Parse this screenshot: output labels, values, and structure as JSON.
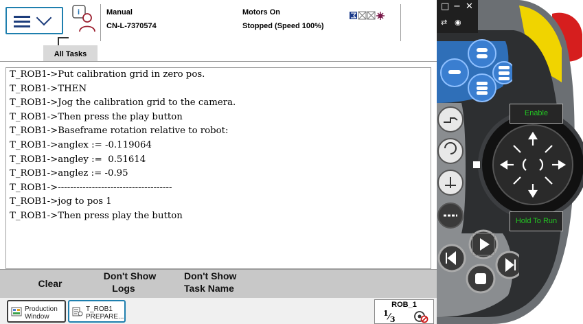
{
  "header": {
    "mode": "Manual",
    "controller_name": "CN-L-7370574",
    "motors_state": "Motors On",
    "run_state": "Stopped (Speed 100%)"
  },
  "tabs": [
    {
      "label": "All Tasks"
    }
  ],
  "log_lines": [
    "T_ROB1->Put calibration grid in zero pos.",
    "T_ROB1->THEN",
    "T_ROB1->Jog the calibration grid to the camera.",
    "T_ROB1->Then press the play button",
    "T_ROB1->Baseframe rotation relative to robot:",
    "T_ROB1->anglex := -0.119064",
    "T_ROB1->angley :=  0.51614",
    "T_ROB1->anglez := -0.95",
    "T_ROB1->-------------------------------------",
    "T_ROB1->jog to pos 1",
    "T_ROB1->Then press play the button"
  ],
  "commands": {
    "clear": "Clear",
    "dont_show_logs_1": "Don't Show",
    "dont_show_logs_2": "Logs",
    "dont_show_task_1": "Don't Show",
    "dont_show_task_2": "Task Name"
  },
  "taskbar": {
    "production_1": "Production",
    "production_2": "Window",
    "trob_1": "T_ROB1",
    "trob_2": "PREPARE..."
  },
  "rob_status": {
    "title": "ROB_1",
    "fraction_num": "1",
    "fraction_den": "3"
  },
  "hardware": {
    "enable_label": "Enable",
    "hold_label": "Hold To Run"
  },
  "colors": {
    "accent_blue": "#1e7fae",
    "pendant_blue": "#2f6fb8",
    "panel_gray": "#c8c8c8",
    "green_text": "#23c423",
    "emergency_red": "#d61e1e",
    "yellow": "#f0d400"
  },
  "icons": [
    "menu-icon",
    "chevron-down-icon",
    "operator-message-icon",
    "status-flags-icon",
    "production-window-icon",
    "task-icon",
    "joystick-arrows-icon",
    "play-icon",
    "stop-icon",
    "step-forward-icon",
    "step-back-icon",
    "emergency-stop-icon"
  ]
}
